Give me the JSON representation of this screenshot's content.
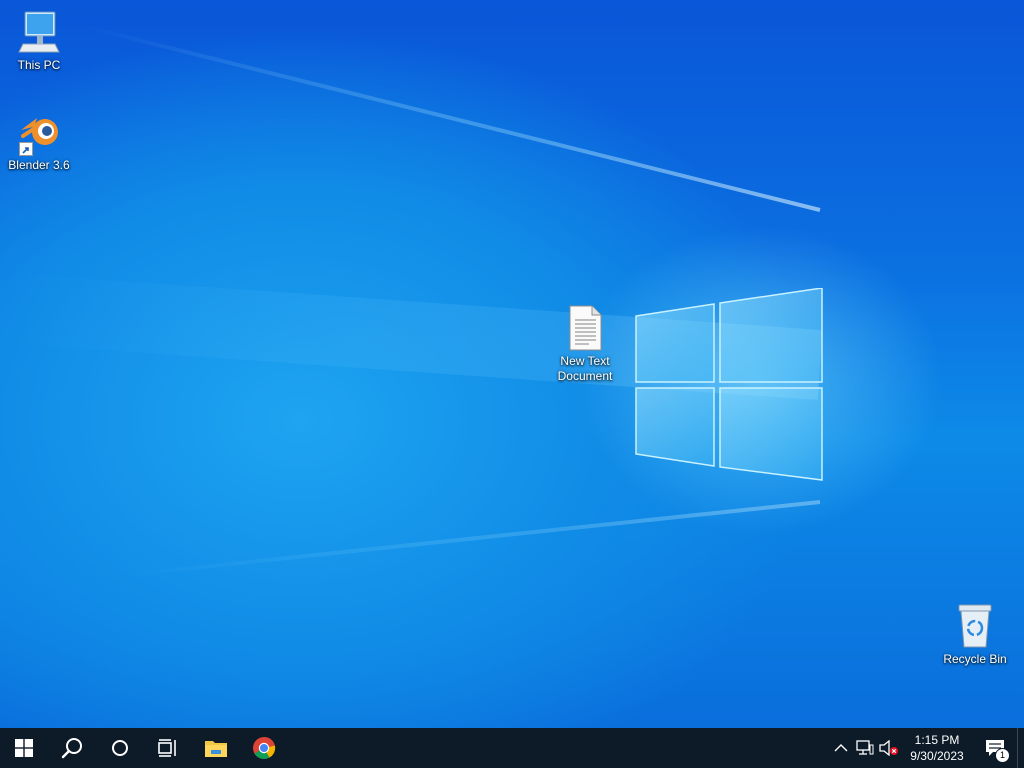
{
  "desktop": {
    "icons": [
      {
        "label": "This PC",
        "icon": "computer-icon"
      },
      {
        "label": "Blender 3.6",
        "icon": "blender-icon"
      },
      {
        "label": "New Text\nDocument",
        "icon": "text-document-icon"
      },
      {
        "label": "Recycle Bin",
        "icon": "recycle-bin-icon"
      }
    ]
  },
  "taskbar": {
    "buttons": [
      {
        "icon": "windows-start-icon"
      },
      {
        "icon": "search-icon"
      },
      {
        "icon": "cortana-icon"
      },
      {
        "icon": "task-view-icon"
      },
      {
        "icon": "file-explorer-icon"
      },
      {
        "icon": "chrome-icon"
      }
    ],
    "tray": {
      "icons": [
        "chevron-up-icon",
        "network-icon",
        "volume-muted-icon"
      ],
      "time": "1:15 PM",
      "date": "9/30/2023",
      "notification_count": "1"
    }
  },
  "colors": {
    "taskbar_bg": "#0d1a28",
    "desktop_accent": "#108be6"
  }
}
